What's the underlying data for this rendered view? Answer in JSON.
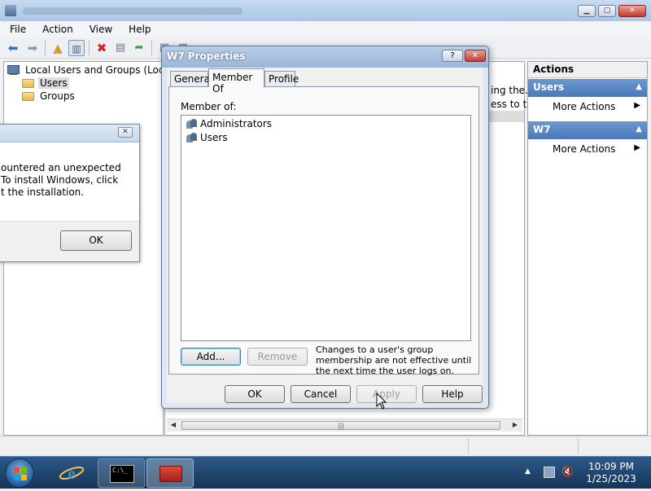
{
  "menu": [
    "File",
    "Action",
    "View",
    "Help"
  ],
  "tree": {
    "root": "Local Users and Groups (Local)",
    "children": [
      "Users",
      "Groups"
    ]
  },
  "mid_fragments": [
    "ing the...",
    "ess to t..."
  ],
  "actions": {
    "header": "Actions",
    "sections": [
      {
        "title": "Users",
        "item": "More Actions"
      },
      {
        "title": "W7",
        "item": "More Actions"
      }
    ]
  },
  "error_dialog": {
    "lines": [
      "ountered an unexpected",
      "To install Windows, click",
      "t the installation."
    ],
    "ok": "OK",
    "close_glyph": "✕"
  },
  "properties": {
    "title": "W7 Properties",
    "help_glyph": "?",
    "close_glyph": "✕",
    "tabs": [
      "General",
      "Member Of",
      "Profile"
    ],
    "active_tab": "Member Of",
    "member_of_label": "Member of:",
    "members": [
      "Administrators",
      "Users"
    ],
    "add_button": "Add...",
    "remove_button": "Remove",
    "note": "Changes to a user's group membership are not effective until the next time the user logs on.",
    "ok": "OK",
    "cancel": "Cancel",
    "apply": "Apply",
    "help": "Help"
  },
  "taskbar": {
    "time": "10:09 PM",
    "date": "1/25/2023",
    "cmd_glyph": "C:\\_"
  },
  "colors": {
    "taskbar_bg": "#1c3f66",
    "action_section": "#4b78b7",
    "title_active": "#a9c6e8"
  },
  "icons": [
    "back-icon",
    "forward-icon",
    "up-folder-icon",
    "show-hide-tree-icon",
    "delete-icon",
    "properties-icon",
    "export-icon",
    "help-icon",
    "console-icon"
  ]
}
